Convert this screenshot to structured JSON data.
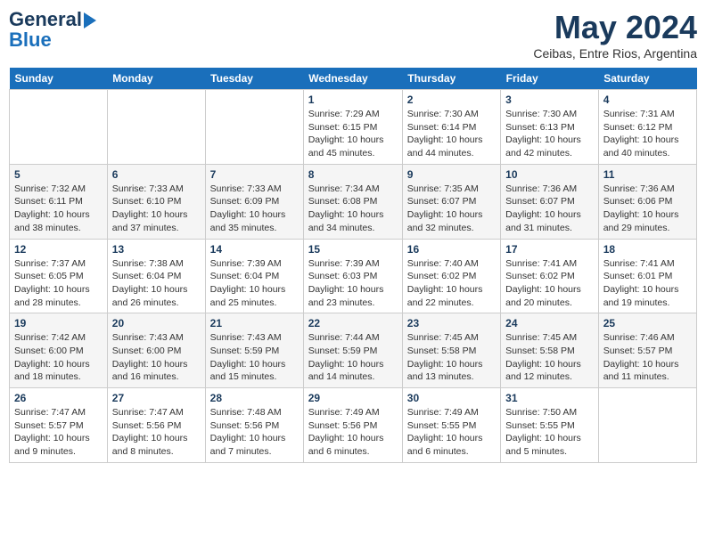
{
  "header": {
    "logo_line1": "General",
    "logo_line2": "Blue",
    "month": "May 2024",
    "location": "Ceibas, Entre Rios, Argentina"
  },
  "weekdays": [
    "Sunday",
    "Monday",
    "Tuesday",
    "Wednesday",
    "Thursday",
    "Friday",
    "Saturday"
  ],
  "weeks": [
    [
      {
        "day": "",
        "info": ""
      },
      {
        "day": "",
        "info": ""
      },
      {
        "day": "",
        "info": ""
      },
      {
        "day": "1",
        "info": "Sunrise: 7:29 AM\nSunset: 6:15 PM\nDaylight: 10 hours\nand 45 minutes."
      },
      {
        "day": "2",
        "info": "Sunrise: 7:30 AM\nSunset: 6:14 PM\nDaylight: 10 hours\nand 44 minutes."
      },
      {
        "day": "3",
        "info": "Sunrise: 7:30 AM\nSunset: 6:13 PM\nDaylight: 10 hours\nand 42 minutes."
      },
      {
        "day": "4",
        "info": "Sunrise: 7:31 AM\nSunset: 6:12 PM\nDaylight: 10 hours\nand 40 minutes."
      }
    ],
    [
      {
        "day": "5",
        "info": "Sunrise: 7:32 AM\nSunset: 6:11 PM\nDaylight: 10 hours\nand 38 minutes."
      },
      {
        "day": "6",
        "info": "Sunrise: 7:33 AM\nSunset: 6:10 PM\nDaylight: 10 hours\nand 37 minutes."
      },
      {
        "day": "7",
        "info": "Sunrise: 7:33 AM\nSunset: 6:09 PM\nDaylight: 10 hours\nand 35 minutes."
      },
      {
        "day": "8",
        "info": "Sunrise: 7:34 AM\nSunset: 6:08 PM\nDaylight: 10 hours\nand 34 minutes."
      },
      {
        "day": "9",
        "info": "Sunrise: 7:35 AM\nSunset: 6:07 PM\nDaylight: 10 hours\nand 32 minutes."
      },
      {
        "day": "10",
        "info": "Sunrise: 7:36 AM\nSunset: 6:07 PM\nDaylight: 10 hours\nand 31 minutes."
      },
      {
        "day": "11",
        "info": "Sunrise: 7:36 AM\nSunset: 6:06 PM\nDaylight: 10 hours\nand 29 minutes."
      }
    ],
    [
      {
        "day": "12",
        "info": "Sunrise: 7:37 AM\nSunset: 6:05 PM\nDaylight: 10 hours\nand 28 minutes."
      },
      {
        "day": "13",
        "info": "Sunrise: 7:38 AM\nSunset: 6:04 PM\nDaylight: 10 hours\nand 26 minutes."
      },
      {
        "day": "14",
        "info": "Sunrise: 7:39 AM\nSunset: 6:04 PM\nDaylight: 10 hours\nand 25 minutes."
      },
      {
        "day": "15",
        "info": "Sunrise: 7:39 AM\nSunset: 6:03 PM\nDaylight: 10 hours\nand 23 minutes."
      },
      {
        "day": "16",
        "info": "Sunrise: 7:40 AM\nSunset: 6:02 PM\nDaylight: 10 hours\nand 22 minutes."
      },
      {
        "day": "17",
        "info": "Sunrise: 7:41 AM\nSunset: 6:02 PM\nDaylight: 10 hours\nand 20 minutes."
      },
      {
        "day": "18",
        "info": "Sunrise: 7:41 AM\nSunset: 6:01 PM\nDaylight: 10 hours\nand 19 minutes."
      }
    ],
    [
      {
        "day": "19",
        "info": "Sunrise: 7:42 AM\nSunset: 6:00 PM\nDaylight: 10 hours\nand 18 minutes."
      },
      {
        "day": "20",
        "info": "Sunrise: 7:43 AM\nSunset: 6:00 PM\nDaylight: 10 hours\nand 16 minutes."
      },
      {
        "day": "21",
        "info": "Sunrise: 7:43 AM\nSunset: 5:59 PM\nDaylight: 10 hours\nand 15 minutes."
      },
      {
        "day": "22",
        "info": "Sunrise: 7:44 AM\nSunset: 5:59 PM\nDaylight: 10 hours\nand 14 minutes."
      },
      {
        "day": "23",
        "info": "Sunrise: 7:45 AM\nSunset: 5:58 PM\nDaylight: 10 hours\nand 13 minutes."
      },
      {
        "day": "24",
        "info": "Sunrise: 7:45 AM\nSunset: 5:58 PM\nDaylight: 10 hours\nand 12 minutes."
      },
      {
        "day": "25",
        "info": "Sunrise: 7:46 AM\nSunset: 5:57 PM\nDaylight: 10 hours\nand 11 minutes."
      }
    ],
    [
      {
        "day": "26",
        "info": "Sunrise: 7:47 AM\nSunset: 5:57 PM\nDaylight: 10 hours\nand 9 minutes."
      },
      {
        "day": "27",
        "info": "Sunrise: 7:47 AM\nSunset: 5:56 PM\nDaylight: 10 hours\nand 8 minutes."
      },
      {
        "day": "28",
        "info": "Sunrise: 7:48 AM\nSunset: 5:56 PM\nDaylight: 10 hours\nand 7 minutes."
      },
      {
        "day": "29",
        "info": "Sunrise: 7:49 AM\nSunset: 5:56 PM\nDaylight: 10 hours\nand 6 minutes."
      },
      {
        "day": "30",
        "info": "Sunrise: 7:49 AM\nSunset: 5:55 PM\nDaylight: 10 hours\nand 6 minutes."
      },
      {
        "day": "31",
        "info": "Sunrise: 7:50 AM\nSunset: 5:55 PM\nDaylight: 10 hours\nand 5 minutes."
      },
      {
        "day": "",
        "info": ""
      }
    ]
  ]
}
